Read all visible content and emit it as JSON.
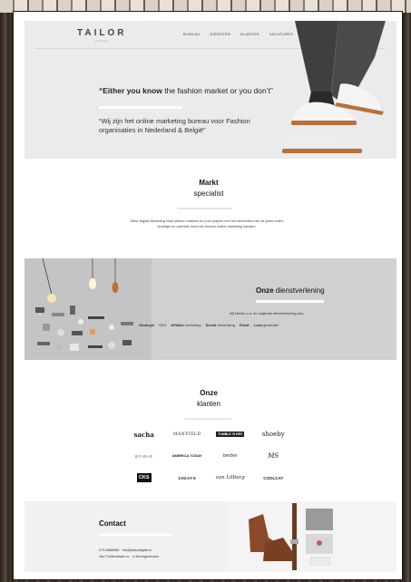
{
  "brand": {
    "name": "TAILOR",
    "sub": "digital"
  },
  "nav": {
    "items": [
      "BUREAU",
      "DIENSTEN",
      "KLANTEN",
      "VACATURES",
      "CONTACT"
    ],
    "search_icon": "search-icon"
  },
  "hero": {
    "quote_bold": "“Either you know",
    "quote_rest": " the fashion market or you don’t”",
    "subtitle": "“Wij zijn het online marketing bureau voor Fashion organisaties in Nederland & België”"
  },
  "markt": {
    "title_bold": "Markt",
    "title_rest": "specialist",
    "text": "Tailor Digital Marketing helpt fashion retailers en pure players met het neerzetten van de juiste online strategie en optimale inzet van diverse online marketing kanalen."
  },
  "diensten": {
    "title_bold": "Onze",
    "title_rest": " dienstverlening",
    "intro": "Wij bieden o.a. de volgende dienstverlening aan:",
    "list": [
      {
        "bold": "Strategie",
        "rest": ""
      },
      {
        "bold": "",
        "rest": "SEA"
      },
      {
        "bold": "Affiliate",
        "rest": " marketing"
      },
      {
        "bold": "Social",
        "rest": " Advertising"
      },
      {
        "bold": "Email",
        "rest": ""
      },
      {
        "bold": "Lead",
        "rest": " generatie"
      }
    ]
  },
  "klanten": {
    "title_bold": "Onze",
    "title_rest": "klanten",
    "logos": [
      "sacha",
      "MANFIELD",
      "TUMBLE 'N DRY",
      "shoeby",
      "BY-BAR",
      "AMERICA TODAY",
      "berden",
      "MS",
      "CKS",
      "10DAYS",
      "van Lilburg",
      "COOLCAT"
    ]
  },
  "contact": {
    "title": "Contact",
    "phone": "073-6868585 · info@tailordigital.nl",
    "address": "Van Tuldenstraat xx · ‘s-Hertogenbosch"
  },
  "colors": {
    "hero_bg": "#ebebeb",
    "services_bg": "#d0d0d0",
    "contact_bg": "#f1f1f1",
    "text": "#222222"
  }
}
